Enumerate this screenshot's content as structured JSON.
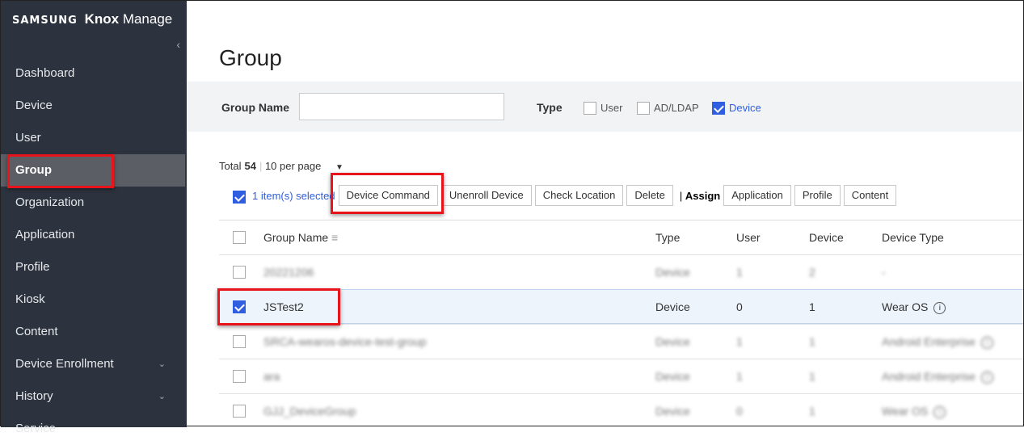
{
  "brand": {
    "samsung": "SAMSUNG",
    "knox": "Knox",
    "manage": "Manage"
  },
  "sidebar": {
    "items": [
      {
        "label": "Dashboard"
      },
      {
        "label": "Device"
      },
      {
        "label": "User"
      },
      {
        "label": "Group",
        "active": true
      },
      {
        "label": "Organization"
      },
      {
        "label": "Application"
      },
      {
        "label": "Profile"
      },
      {
        "label": "Kiosk"
      },
      {
        "label": "Content"
      },
      {
        "label": "Device Enrollment",
        "expandable": true
      },
      {
        "label": "History",
        "expandable": true
      },
      {
        "label": "Service"
      }
    ]
  },
  "page": {
    "title": "Group"
  },
  "filter": {
    "group_name_label": "Group Name",
    "group_name_value": "",
    "type_label": "Type",
    "types": [
      {
        "label": "User",
        "checked": false
      },
      {
        "label": "AD/LDAP",
        "checked": false
      },
      {
        "label": "Device",
        "checked": true
      }
    ]
  },
  "summary": {
    "total_label": "Total",
    "total": "54",
    "per_page": "10 per page"
  },
  "toolbar": {
    "selected": "1 item(s) selected",
    "buttons": [
      "Device Command",
      "Unenroll Device",
      "Check Location",
      "Delete"
    ],
    "assign_label": "Assign",
    "assign_buttons": [
      "Application",
      "Profile",
      "Content"
    ]
  },
  "table": {
    "columns": [
      "Group Name",
      "Type",
      "User",
      "Device",
      "Device Type"
    ],
    "rows": [
      {
        "name": "20221206",
        "type": "Device",
        "user": "1",
        "device": "2",
        "device_type": "-",
        "checked": false,
        "blurred": true
      },
      {
        "name": "JSTest2",
        "type": "Device",
        "user": "0",
        "device": "1",
        "device_type": "Wear OS",
        "checked": true,
        "blurred": false
      },
      {
        "name": "SRCA-wearos-device-test-group",
        "type": "Device",
        "user": "1",
        "device": "1",
        "device_type": "Android Enterprise",
        "checked": false,
        "blurred": true
      },
      {
        "name": "ara",
        "type": "Device",
        "user": "1",
        "device": "1",
        "device_type": "Android Enterprise",
        "checked": false,
        "blurred": true
      },
      {
        "name": "GJJ_DeviceGroup",
        "type": "Device",
        "user": "0",
        "device": "1",
        "device_type": "Wear OS",
        "checked": false,
        "blurred": true
      }
    ]
  },
  "colors": {
    "sidebar": "#2d333e",
    "accent": "#2f5ee0",
    "highlight": "#e8141b"
  }
}
